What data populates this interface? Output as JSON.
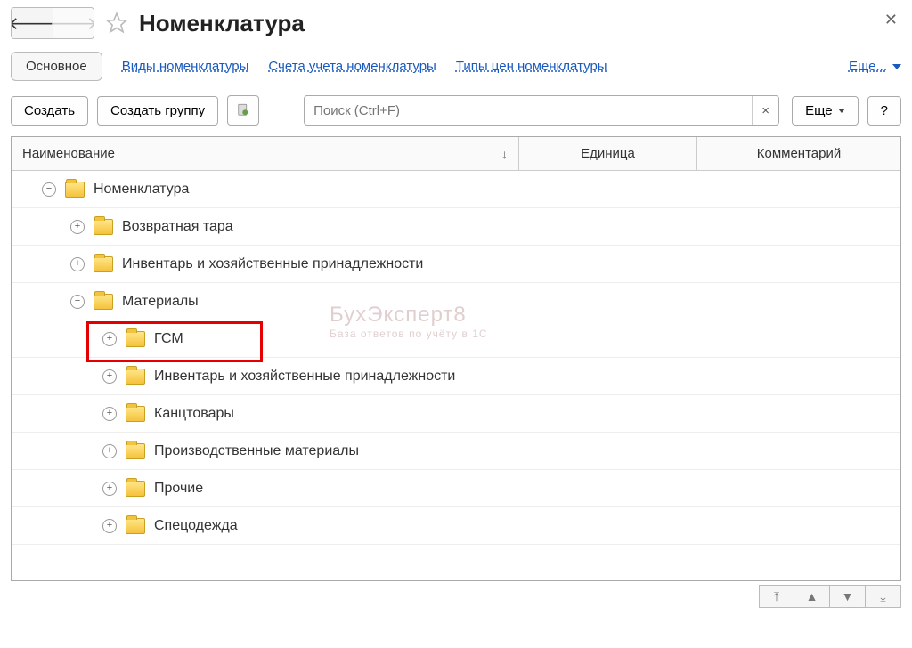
{
  "title": "Номенклатура",
  "tabs": {
    "main": "Основное",
    "links": [
      "Виды номенклатуры",
      "Счета учета номенклатуры",
      "Типы цен номенклатуры"
    ],
    "more": "Еще..."
  },
  "toolbar": {
    "create": "Создать",
    "create_group": "Создать группу",
    "search_placeholder": "Поиск (Ctrl+F)",
    "more": "Еще",
    "help": "?"
  },
  "columns": {
    "name": "Наименование",
    "unit": "Единица",
    "comment": "Комментарий"
  },
  "tree": {
    "root": "Номенклатура",
    "l1a": "Возвратная тара",
    "l1b": "Инвентарь и хозяйственные принадлежности",
    "l1c": "Материалы",
    "l2a": "ГСМ",
    "l2b": "Инвентарь и хозяйственные принадлежности",
    "l2c": "Канцтовары",
    "l2d": "Производственные материалы",
    "l2e": "Прочие",
    "l2f": "Спецодежда"
  },
  "watermark": {
    "line1": "БухЭксперт8",
    "line2": "База ответов по учёту в 1С"
  }
}
